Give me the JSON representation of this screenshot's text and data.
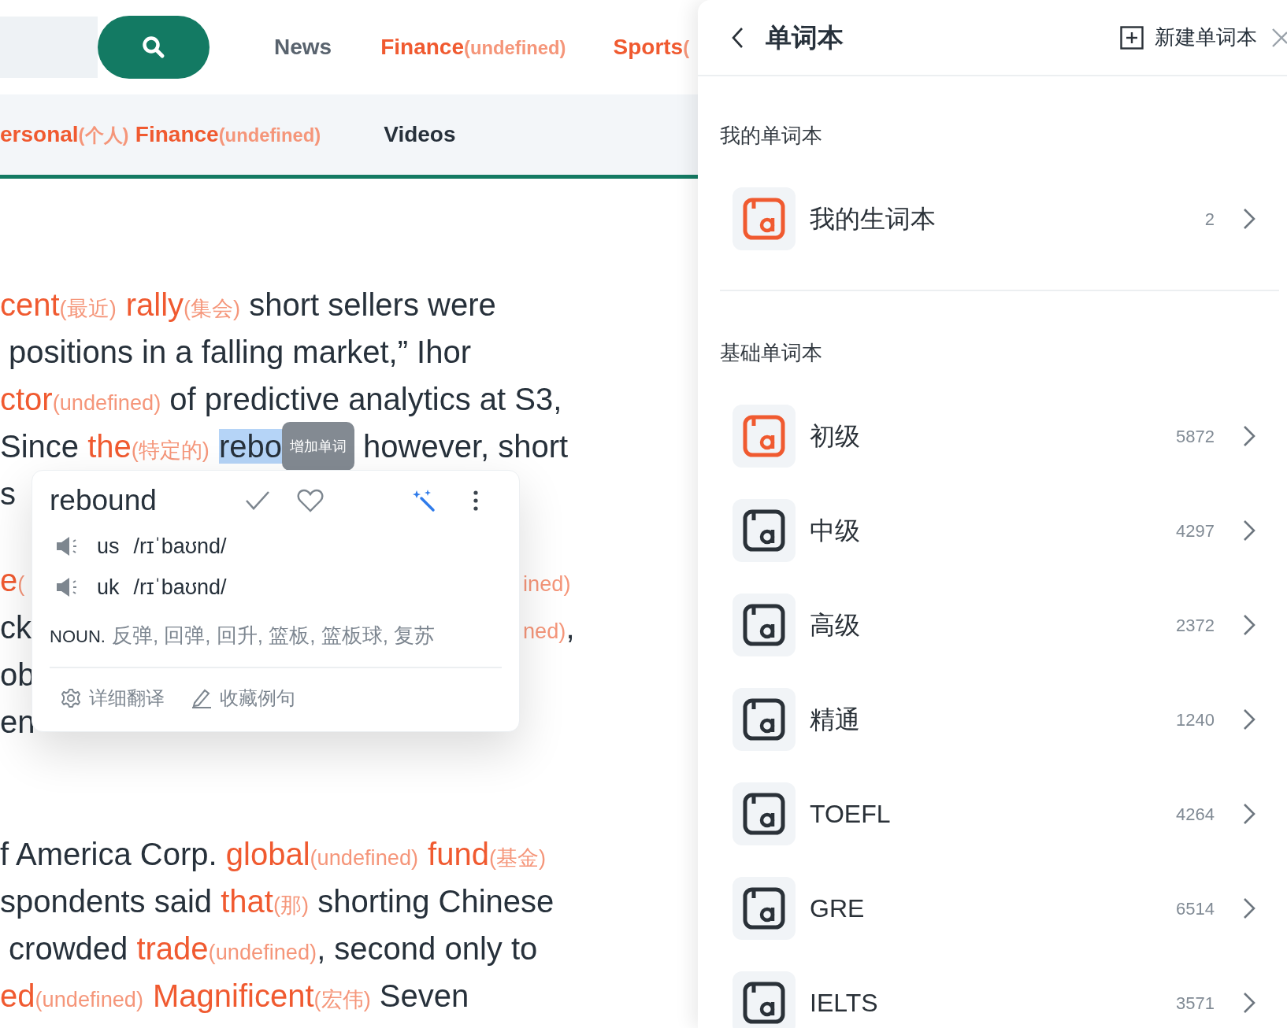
{
  "nav": [
    {
      "kind": "plain",
      "t": "News"
    },
    {
      "kind": "word",
      "t": "Finance",
      "gloss": "(undefined)"
    },
    {
      "kind": "word",
      "t": "Sports",
      "gloss": "("
    }
  ],
  "subnav": [
    [
      {
        "kind": "word",
        "t": "ersonal",
        "gloss": "(个人)"
      },
      {
        "kind": "word",
        "t": "Finance",
        "gloss": "(undefined)"
      }
    ],
    [
      {
        "kind": "plain",
        "t": "Videos"
      }
    ]
  ],
  "article": [
    {
      "lines": [
        [
          [
            {
              "kind": "word",
              "t": "cent",
              "gloss": "(最近)"
            },
            {
              "kind": "word",
              "t": "rally",
              "gloss": "(集会)"
            },
            {
              "kind": "plain",
              "t": " short sellers were"
            }
          ]
        ],
        [
          [
            {
              "kind": "plain",
              "t": " positions in a falling market,” Ihor"
            }
          ]
        ],
        [
          [
            {
              "kind": "word",
              "t": "ctor",
              "gloss": "(undefined)"
            },
            {
              "kind": "plain",
              "t": " of predictive analytics at S3,"
            }
          ]
        ],
        [
          [
            {
              "kind": "plain",
              "t": "Since "
            },
            {
              "kind": "word",
              "t": "the",
              "gloss": "(特定的)"
            },
            {
              "kind": "selected",
              "t": "rebo"
            },
            {
              "kind": "tooltip",
              "t": "增加单词"
            },
            {
              "kind": "plain",
              "t": " however, short"
            }
          ]
        ],
        [
          [
            {
              "kind": "plain",
              "t": "s"
            }
          ]
        ]
      ]
    },
    {
      "lines": [
        [
          [
            {
              "kind": "word",
              "t": "e",
              "gloss": "("
            }
          ],
          [
            {
              "kind": "gloss",
              "t": "ined)"
            }
          ]
        ],
        [
          [
            {
              "kind": "plain",
              "t": "ck"
            }
          ],
          [
            {
              "kind": "gloss",
              "t": "ned)"
            },
            {
              "kind": "plain",
              "t": ","
            }
          ]
        ],
        [
          [
            {
              "kind": "plain",
              "t": "ob"
            }
          ]
        ],
        [
          [
            {
              "kind": "plain",
              "t": "en"
            }
          ]
        ]
      ]
    },
    {
      "lines": [
        [
          [
            {
              "kind": "plain",
              "t": "f America Corp. "
            },
            {
              "kind": "word",
              "t": "global",
              "gloss": "(undefined)"
            },
            {
              "kind": "word",
              "t": "fund",
              "gloss": "(基金)"
            }
          ]
        ],
        [
          [
            {
              "kind": "plain",
              "t": "spondents said "
            },
            {
              "kind": "word",
              "t": "that",
              "gloss": "(那)"
            },
            {
              "kind": "plain",
              "t": " shorting Chinese"
            }
          ]
        ],
        [
          [
            {
              "kind": "plain",
              "t": " crowded "
            },
            {
              "kind": "word",
              "t": "trade",
              "gloss": "(undefined)"
            },
            {
              "kind": "plain",
              "t": ", second only to"
            }
          ]
        ],
        [
          [
            {
              "kind": "word",
              "t": "ed",
              "gloss": "(undefined)"
            },
            {
              "kind": "word",
              "t": "Magnificent",
              "gloss": "(宏伟)"
            },
            {
              "kind": "plain",
              "t": " Seven"
            }
          ]
        ]
      ]
    }
  ],
  "popup": {
    "word": "rebound",
    "prons": [
      {
        "region": "us",
        "ipa": "/rɪˈbaʊnd/"
      },
      {
        "region": "uk",
        "ipa": "/rɪˈbaʊnd/"
      }
    ],
    "pos": "NOUN.",
    "meanings": "反弹, 回弹, 回升, 篮板, 篮板球, 复苏",
    "actions": [
      {
        "kind": "gear",
        "label": "详细翻译"
      },
      {
        "kind": "pencil",
        "label": "收藏例句"
      }
    ]
  },
  "panel": {
    "title": "单词本",
    "new_label": "新建单词本",
    "sections": [
      {
        "title": "我的单词本",
        "books": [
          {
            "name": "我的生词本",
            "count": "2",
            "color": "#f05a30"
          }
        ]
      },
      {
        "title": "基础单词本",
        "books": [
          {
            "name": "初级",
            "count": "5872",
            "color": "#f05a30"
          },
          {
            "name": "中级",
            "count": "4297",
            "color": "#2a3138"
          },
          {
            "name": "高级",
            "count": "2372",
            "color": "#2a3138"
          },
          {
            "name": "精通",
            "count": "1240",
            "color": "#2a3138"
          },
          {
            "name": "TOEFL",
            "count": "4264",
            "color": "#2a3138"
          },
          {
            "name": "GRE",
            "count": "6514",
            "color": "#2a3138"
          },
          {
            "name": "IELTS",
            "count": "3571",
            "color": "#2a3138"
          }
        ]
      }
    ]
  }
}
